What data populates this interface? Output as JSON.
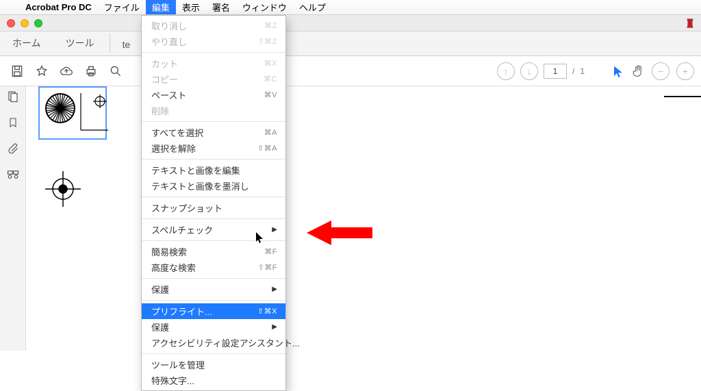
{
  "menubar": {
    "app": "Acrobat Pro DC",
    "items": [
      "ファイル",
      "編集",
      "表示",
      "署名",
      "ウィンドウ",
      "ヘルプ"
    ],
    "active_index": 1
  },
  "tabs": {
    "home": "ホーム",
    "tools": "ツール",
    "doc": "te"
  },
  "toolbar": {
    "page_current": "1",
    "page_sep": "/",
    "page_total": "1"
  },
  "dropdown": {
    "groups": [
      [
        {
          "label": "取り消し",
          "shortcut": "⌘Z",
          "disabled": true
        },
        {
          "label": "やり直し",
          "shortcut": "⇧⌘Z",
          "disabled": true
        }
      ],
      [
        {
          "label": "カット",
          "shortcut": "⌘X",
          "disabled": true
        },
        {
          "label": "コピー",
          "shortcut": "⌘C",
          "disabled": true
        },
        {
          "label": "ペースト",
          "shortcut": "⌘V",
          "disabled": false
        },
        {
          "label": "削除",
          "shortcut": "",
          "disabled": true
        }
      ],
      [
        {
          "label": "すべてを選択",
          "shortcut": "⌘A",
          "disabled": false
        },
        {
          "label": "選択を解除",
          "shortcut": "⇧⌘A",
          "disabled": false
        }
      ],
      [
        {
          "label": "テキストと画像を編集",
          "shortcut": "",
          "disabled": false
        },
        {
          "label": "テキストと画像を墨消し",
          "shortcut": "",
          "disabled": false
        }
      ],
      [
        {
          "label": "スナップショット",
          "shortcut": "",
          "disabled": false
        }
      ],
      [
        {
          "label": "スペルチェック",
          "shortcut": "",
          "disabled": false,
          "submenu": true
        }
      ],
      [
        {
          "label": "簡易検索",
          "shortcut": "⌘F",
          "disabled": false
        },
        {
          "label": "高度な検索",
          "shortcut": "⇧⌘F",
          "disabled": false
        }
      ],
      [
        {
          "label": "保護",
          "shortcut": "",
          "disabled": false,
          "submenu": true
        }
      ],
      [
        {
          "label": "プリフライト...",
          "shortcut": "⇧⌘X",
          "disabled": false,
          "highlight": true
        },
        {
          "label": "保護",
          "shortcut": "",
          "disabled": false,
          "submenu": true
        },
        {
          "label": "アクセシビリティ設定アシスタント...",
          "shortcut": "",
          "disabled": false
        }
      ],
      [
        {
          "label": "ツールを管理",
          "shortcut": "",
          "disabled": false
        },
        {
          "label": "特殊文字...",
          "shortcut": "",
          "disabled": false
        }
      ]
    ]
  }
}
